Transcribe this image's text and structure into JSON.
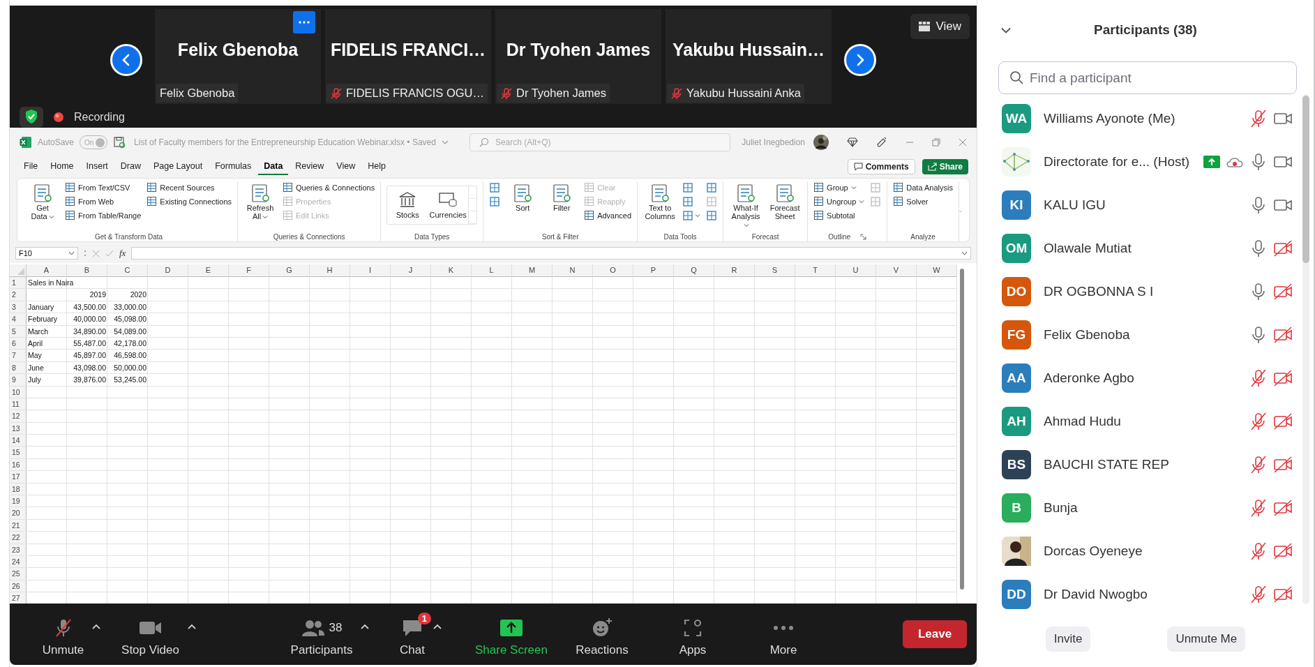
{
  "video_strip": {
    "tiles": [
      {
        "name": "Felix Gbenoba",
        "label": "Felix Gbenoba",
        "muted": false,
        "menu_button": true
      },
      {
        "name": "FIDELIS FRANCI…",
        "label": "FIDELIS FRANCIS OGU…",
        "muted": true,
        "menu_button": false
      },
      {
        "name": "Dr Tyohen James",
        "label": "Dr Tyohen James",
        "muted": true,
        "menu_button": false
      },
      {
        "name": "Yakubu Hussain…",
        "label": "Yakubu Hussaini Anka",
        "muted": true,
        "menu_button": false
      }
    ],
    "view_button": "View",
    "recording": "Recording"
  },
  "excel": {
    "autosave": "AutoSave",
    "autosave_toggle": "On",
    "file_title": "List of Faculty members for the Entrepreneurship Education Webinar.xlsx • Saved",
    "search_placeholder": "Search (Alt+Q)",
    "user": "Juliet Inegbedion",
    "tabs": [
      {
        "label": "File",
        "selected": false
      },
      {
        "label": "Home",
        "selected": false
      },
      {
        "label": "Insert",
        "selected": false
      },
      {
        "label": "Draw",
        "selected": false
      },
      {
        "label": "Page Layout",
        "selected": false
      },
      {
        "label": "Formulas",
        "selected": false
      },
      {
        "label": "Data",
        "selected": true
      },
      {
        "label": "Review",
        "selected": false
      },
      {
        "label": "View",
        "selected": false
      },
      {
        "label": "Help",
        "selected": false
      }
    ],
    "comments": "Comments",
    "share": "Share",
    "ribbon": [
      {
        "label": "Get & Transform Data",
        "launcher": false,
        "columns": [
          {
            "kind": "large",
            "items": [
              {
                "label": "Get Data",
                "dropdown": true,
                "disabled": false
              }
            ]
          },
          {
            "kind": "stack",
            "items": [
              {
                "label": "From Text/CSV",
                "dropdown": false,
                "disabled": false
              },
              {
                "label": "From Web",
                "dropdown": false,
                "disabled": false
              },
              {
                "label": "From Table/Range",
                "dropdown": false,
                "disabled": false
              }
            ]
          },
          {
            "kind": "stack",
            "items": [
              {
                "label": "Recent Sources",
                "dropdown": false,
                "disabled": false
              },
              {
                "label": "Existing Connections",
                "dropdown": false,
                "disabled": false
              }
            ]
          }
        ]
      },
      {
        "label": "Queries & Connections",
        "launcher": false,
        "columns": [
          {
            "kind": "large",
            "items": [
              {
                "label": "Refresh All",
                "dropdown": true,
                "disabled": false
              }
            ]
          },
          {
            "kind": "stack",
            "items": [
              {
                "label": "Queries & Connections",
                "dropdown": false,
                "disabled": false
              },
              {
                "label": "Properties",
                "dropdown": false,
                "disabled": true
              },
              {
                "label": "Edit Links",
                "dropdown": false,
                "disabled": true
              }
            ]
          }
        ]
      },
      {
        "label": "Data Types",
        "launcher": false,
        "columns": [
          {
            "kind": "gallery",
            "items": [
              {
                "label": "Stocks",
                "disabled": false
              },
              {
                "label": "Currencies",
                "disabled": false
              }
            ]
          }
        ]
      },
      {
        "label": "Sort & Filter",
        "launcher": false,
        "columns": [
          {
            "kind": "icons",
            "items": [
              {
                "dropdown": false,
                "disabled": false
              },
              {
                "dropdown": false,
                "disabled": false
              }
            ]
          },
          {
            "kind": "large",
            "items": [
              {
                "label": "Sort",
                "dropdown": false,
                "disabled": false
              },
              {
                "label": "Filter",
                "dropdown": false,
                "disabled": false
              }
            ]
          },
          {
            "kind": "stack",
            "items": [
              {
                "label": "Clear",
                "dropdown": false,
                "disabled": true
              },
              {
                "label": "Reapply",
                "dropdown": false,
                "disabled": true
              },
              {
                "label": "Advanced",
                "dropdown": false,
                "disabled": false
              }
            ]
          }
        ]
      },
      {
        "label": "Data Tools",
        "launcher": false,
        "columns": [
          {
            "kind": "large",
            "items": [
              {
                "label": "Text to Columns",
                "dropdown": false,
                "disabled": false
              }
            ]
          },
          {
            "kind": "icons",
            "items": [
              {
                "dropdown": false,
                "disabled": false
              },
              {
                "dropdown": false,
                "disabled": false
              },
              {
                "dropdown": true,
                "disabled": false
              }
            ]
          },
          {
            "kind": "icons",
            "items": [
              {
                "dropdown": false,
                "disabled": false
              },
              {
                "dropdown": false,
                "disabled": true
              },
              {
                "dropdown": false,
                "disabled": false
              }
            ]
          }
        ]
      },
      {
        "label": "Forecast",
        "launcher": false,
        "columns": [
          {
            "kind": "large",
            "items": [
              {
                "label": "What-If Analysis",
                "dropdown": true,
                "disabled": false
              },
              {
                "label": "Forecast Sheet",
                "dropdown": false,
                "disabled": false
              }
            ]
          }
        ]
      },
      {
        "label": "Outline",
        "launcher": true,
        "columns": [
          {
            "kind": "stack",
            "items": [
              {
                "label": "Group",
                "dropdown": true,
                "disabled": false
              },
              {
                "label": "Ungroup",
                "dropdown": true,
                "disabled": false
              },
              {
                "label": "Subtotal",
                "dropdown": false,
                "disabled": false
              }
            ]
          },
          {
            "kind": "icons",
            "items": [
              {
                "dropdown": false,
                "disabled": true
              },
              {
                "dropdown": false,
                "disabled": true
              }
            ]
          }
        ]
      },
      {
        "label": "Analyze",
        "launcher": false,
        "columns": [
          {
            "kind": "stack",
            "items": [
              {
                "label": "Data Analysis",
                "dropdown": false,
                "disabled": false
              },
              {
                "label": "Solver",
                "dropdown": false,
                "disabled": false
              }
            ]
          }
        ]
      }
    ],
    "sheet": {
      "name_box": "F10",
      "formula_label": "fx",
      "columns": [
        "A",
        "B",
        "C",
        "D",
        "E",
        "F",
        "G",
        "H",
        "I",
        "J",
        "K",
        "L",
        "M",
        "N",
        "O",
        "P",
        "Q",
        "R",
        "S",
        "T",
        "U",
        "V",
        "W"
      ],
      "rows": [
        {
          "number": "1",
          "cells": [
            "Sales in Naira"
          ]
        },
        {
          "number": "2",
          "cells": [
            null,
            "2019",
            "2020"
          ]
        },
        {
          "number": "3",
          "cells": [
            "January",
            "43,500.00",
            "33,000.00"
          ]
        },
        {
          "number": "4",
          "cells": [
            "February",
            "40,000.00",
            "45,098.00"
          ]
        },
        {
          "number": "5",
          "cells": [
            "March",
            "34,890.00",
            "54,089.00"
          ]
        },
        {
          "number": "6",
          "cells": [
            "April",
            "55,487.00",
            "42,178.00"
          ]
        },
        {
          "number": "7",
          "cells": [
            "May",
            "45,897.00",
            "46,598.00"
          ]
        },
        {
          "number": "8",
          "cells": [
            "June",
            "43,098.00",
            "50,000.00"
          ]
        },
        {
          "number": "9",
          "cells": [
            "July",
            "39,876.00",
            "53,245.00"
          ]
        },
        {
          "number": "10"
        },
        {
          "number": "11"
        },
        {
          "number": "12"
        },
        {
          "number": "13"
        },
        {
          "number": "14"
        },
        {
          "number": "15"
        },
        {
          "number": "16"
        },
        {
          "number": "17"
        },
        {
          "number": "18"
        },
        {
          "number": "19"
        },
        {
          "number": "20"
        },
        {
          "number": "21"
        },
        {
          "number": "22"
        },
        {
          "number": "23"
        },
        {
          "number": "24"
        },
        {
          "number": "25"
        },
        {
          "number": "26"
        },
        {
          "number": "27"
        }
      ]
    }
  },
  "toolbar": {
    "buttons": [
      {
        "label": "Unmute",
        "kind": "mic",
        "caret": true
      },
      {
        "label": "Stop Video",
        "kind": "video",
        "caret": true
      },
      {
        "label": "Participants",
        "kind": "participants",
        "count": "38",
        "caret": true
      },
      {
        "label": "Chat",
        "kind": "chat",
        "badge": "1",
        "caret": true
      },
      {
        "label": "Share Screen",
        "kind": "share",
        "caret": false
      },
      {
        "label": "Reactions",
        "kind": "reactions",
        "caret": false
      },
      {
        "label": "Apps",
        "kind": "apps",
        "caret": false
      },
      {
        "label": "More",
        "kind": "more",
        "caret": false
      }
    ],
    "leave": "Leave"
  },
  "panel": {
    "title": "Participants (38)",
    "search_placeholder": "Find a participant",
    "items": [
      {
        "name": "Williams Ayonote (Me)",
        "kind": "initials",
        "initials": "WA",
        "color": "#1a9a7f",
        "mic_muted": true,
        "video_on": true,
        "sharing": false,
        "recording": false
      },
      {
        "name": "Directorate for e... (Host)",
        "kind": "picture",
        "mic_muted": false,
        "video_on": true,
        "sharing": true,
        "recording": true
      },
      {
        "name": "KALU IGU",
        "kind": "initials",
        "initials": "KI",
        "color": "#2b7dbc",
        "mic_muted": false,
        "video_on": true,
        "sharing": false,
        "recording": false
      },
      {
        "name": "Olawale Mutiat",
        "kind": "initials",
        "initials": "OM",
        "color": "#1a9a7f",
        "mic_muted": false,
        "video_on": false,
        "sharing": false,
        "recording": false
      },
      {
        "name": "DR OGBONNA S I",
        "kind": "initials",
        "initials": "DO",
        "color": "#d4570c",
        "mic_muted": false,
        "video_on": false,
        "sharing": false,
        "recording": false
      },
      {
        "name": "Felix Gbenoba",
        "kind": "initials",
        "initials": "FG",
        "color": "#d4570c",
        "mic_muted": false,
        "video_on": false,
        "sharing": false,
        "recording": false
      },
      {
        "name": "Aderonke Agbo",
        "kind": "initials",
        "initials": "AA",
        "color": "#2b7dbc",
        "mic_muted": true,
        "video_on": false,
        "sharing": false,
        "recording": false
      },
      {
        "name": "Ahmad Hudu",
        "kind": "initials",
        "initials": "AH",
        "color": "#1a9a7f",
        "mic_muted": true,
        "video_on": false,
        "sharing": false,
        "recording": false
      },
      {
        "name": "BAUCHI STATE REP",
        "kind": "initials",
        "initials": "BS",
        "color": "#2e4257",
        "mic_muted": true,
        "video_on": false,
        "sharing": false,
        "recording": false
      },
      {
        "name": "Bunja",
        "kind": "initials",
        "initials": "B",
        "color": "#2aad5c",
        "mic_muted": true,
        "video_on": false,
        "sharing": false,
        "recording": false
      },
      {
        "name": "Dorcas Oyeneye",
        "kind": "picture",
        "mic_muted": true,
        "video_on": false,
        "sharing": false,
        "recording": false
      },
      {
        "name": "Dr David Nwogbo",
        "kind": "initials",
        "initials": "DD",
        "color": "#2b7dbc",
        "mic_muted": true,
        "video_on": false,
        "sharing": false,
        "recording": false
      }
    ],
    "buttons": [
      "Invite",
      "Unmute Me"
    ]
  }
}
